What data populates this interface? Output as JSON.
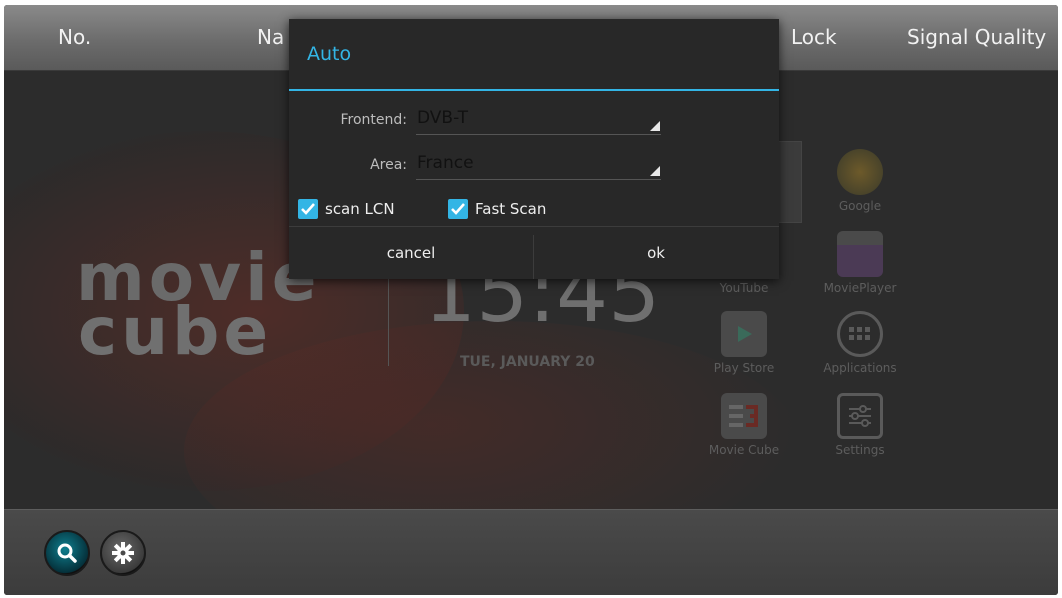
{
  "header": {
    "columns": [
      "No.",
      "Na",
      "Lock",
      "Signal Quality"
    ]
  },
  "background": {
    "logo_line1": "movie",
    "logo_line2": "cube",
    "clock": "15:45",
    "date": "TUE, JANUARY 20",
    "apps": [
      {
        "label": "Google"
      },
      {
        "label": "YouTube"
      },
      {
        "label": "MoviePlayer"
      },
      {
        "label": "Play Store"
      },
      {
        "label": "Applications"
      },
      {
        "label": "Movie Cube"
      },
      {
        "label": "Settings"
      }
    ]
  },
  "dialog": {
    "title": "Auto",
    "frontend_label": "Frontend:",
    "frontend_value": "DVB-T",
    "area_label": "Area:",
    "area_value": "France",
    "scan_lcn_label": "scan LCN",
    "scan_lcn_checked": true,
    "fast_scan_label": "Fast Scan",
    "fast_scan_checked": true,
    "cancel_label": "cancel",
    "ok_label": "ok"
  },
  "bottom": {
    "buttons": [
      "search-icon",
      "gear-icon"
    ]
  },
  "colors": {
    "accent": "#33b5e5",
    "check": "#33b5e5"
  }
}
